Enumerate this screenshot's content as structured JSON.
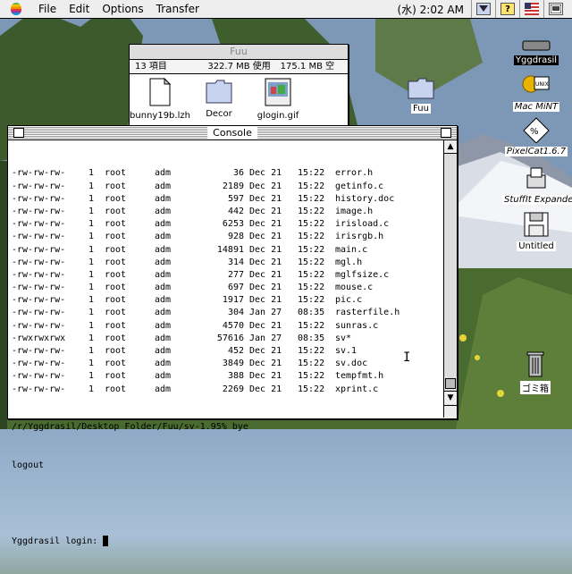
{
  "menubar": {
    "file": "File",
    "edit": "Edit",
    "options": "Options",
    "transfer": "Transfer",
    "clock": "(水) 2:02 AM",
    "help_icon": "?"
  },
  "finder": {
    "title": "Fuu",
    "items_count": "13 項目",
    "used": "322.7 MB 使用",
    "available": "175.1 MB 空",
    "files": [
      {
        "name": "bunny19b.lzh",
        "icon": "document-icon"
      },
      {
        "name": "Decor",
        "icon": "folder-icon"
      },
      {
        "name": "glogin.gif",
        "icon": "image-icon"
      }
    ]
  },
  "console": {
    "title": "Console",
    "listing": [
      {
        "perm": "-rw-rw-rw-",
        "links": "1",
        "owner": "root",
        "group": "adm",
        "size": "36",
        "date": "Dec 21",
        "time": "15:22",
        "name": "error.h"
      },
      {
        "perm": "-rw-rw-rw-",
        "links": "1",
        "owner": "root",
        "group": "adm",
        "size": "2189",
        "date": "Dec 21",
        "time": "15:22",
        "name": "getinfo.c"
      },
      {
        "perm": "-rw-rw-rw-",
        "links": "1",
        "owner": "root",
        "group": "adm",
        "size": "597",
        "date": "Dec 21",
        "time": "15:22",
        "name": "history.doc"
      },
      {
        "perm": "-rw-rw-rw-",
        "links": "1",
        "owner": "root",
        "group": "adm",
        "size": "442",
        "date": "Dec 21",
        "time": "15:22",
        "name": "image.h"
      },
      {
        "perm": "-rw-rw-rw-",
        "links": "1",
        "owner": "root",
        "group": "adm",
        "size": "6253",
        "date": "Dec 21",
        "time": "15:22",
        "name": "irisload.c"
      },
      {
        "perm": "-rw-rw-rw-",
        "links": "1",
        "owner": "root",
        "group": "adm",
        "size": "928",
        "date": "Dec 21",
        "time": "15:22",
        "name": "irisrgb.h"
      },
      {
        "perm": "-rw-rw-rw-",
        "links": "1",
        "owner": "root",
        "group": "adm",
        "size": "14891",
        "date": "Dec 21",
        "time": "15:22",
        "name": "main.c"
      },
      {
        "perm": "-rw-rw-rw-",
        "links": "1",
        "owner": "root",
        "group": "adm",
        "size": "314",
        "date": "Dec 21",
        "time": "15:22",
        "name": "mgl.h"
      },
      {
        "perm": "-rw-rw-rw-",
        "links": "1",
        "owner": "root",
        "group": "adm",
        "size": "277",
        "date": "Dec 21",
        "time": "15:22",
        "name": "mglfsize.c"
      },
      {
        "perm": "-rw-rw-rw-",
        "links": "1",
        "owner": "root",
        "group": "adm",
        "size": "697",
        "date": "Dec 21",
        "time": "15:22",
        "name": "mouse.c"
      },
      {
        "perm": "-rw-rw-rw-",
        "links": "1",
        "owner": "root",
        "group": "adm",
        "size": "1917",
        "date": "Dec 21",
        "time": "15:22",
        "name": "pic.c"
      },
      {
        "perm": "-rw-rw-rw-",
        "links": "1",
        "owner": "root",
        "group": "adm",
        "size": "304",
        "date": "Jan 27",
        "time": "08:35",
        "name": "rasterfile.h"
      },
      {
        "perm": "-rw-rw-rw-",
        "links": "1",
        "owner": "root",
        "group": "adm",
        "size": "4570",
        "date": "Dec 21",
        "time": "15:22",
        "name": "sunras.c"
      },
      {
        "perm": "-rwxrwxrwx",
        "links": "1",
        "owner": "root",
        "group": "adm",
        "size": "57616",
        "date": "Jan 27",
        "time": "08:35",
        "name": "sv*"
      },
      {
        "perm": "-rw-rw-rw-",
        "links": "1",
        "owner": "root",
        "group": "adm",
        "size": "452",
        "date": "Dec 21",
        "time": "15:22",
        "name": "sv.1"
      },
      {
        "perm": "-rw-rw-rw-",
        "links": "1",
        "owner": "root",
        "group": "adm",
        "size": "3849",
        "date": "Dec 21",
        "time": "15:22",
        "name": "sv.doc"
      },
      {
        "perm": "-rw-rw-rw-",
        "links": "1",
        "owner": "root",
        "group": "adm",
        "size": "388",
        "date": "Dec 21",
        "time": "15:22",
        "name": "tempfmt.h"
      },
      {
        "perm": "-rw-rw-rw-",
        "links": "1",
        "owner": "root",
        "group": "adm",
        "size": "2269",
        "date": "Dec 21",
        "time": "15:22",
        "name": "xprint.c"
      }
    ],
    "prompt_line": "/r/Yggdrasil/Desktop Folder/Fuu/sv-1.95% bye",
    "logout_line": "logout",
    "login_line": "Yggdrasil login: "
  },
  "desktop": {
    "icons": [
      {
        "label": "Yggdrasil",
        "icon": "hard-disk-icon",
        "selected": true
      },
      {
        "label": "Mac MiNT",
        "icon": "mac-mint-icon",
        "selected": false
      },
      {
        "label": "PixelCat1.6.7",
        "icon": "pixelcat-icon",
        "selected": false
      },
      {
        "label": "StuffIt Expander",
        "icon": "stuffit-icon",
        "selected": false
      },
      {
        "label": "Untitled",
        "icon": "floppy-disk-icon",
        "selected": false
      },
      {
        "label": "Fuu",
        "icon": "folder-icon",
        "selected": false
      },
      {
        "label": "ゴミ箱",
        "icon": "trash-icon",
        "selected": false
      }
    ]
  }
}
